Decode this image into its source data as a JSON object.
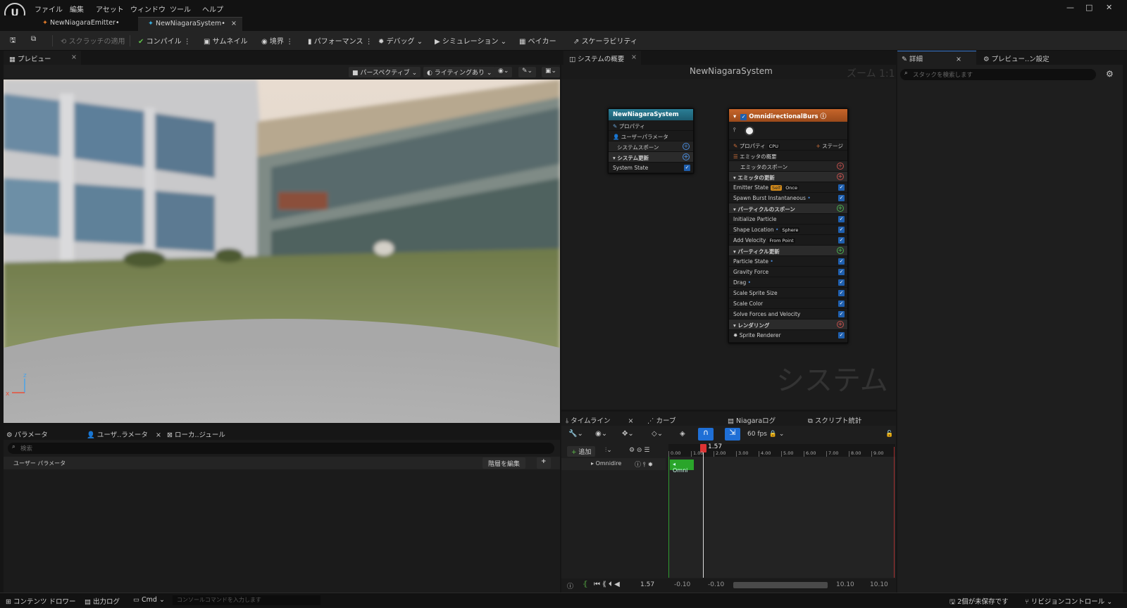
{
  "menu": {
    "items": [
      "ファイル",
      "編集",
      "アセット",
      "ウィンドウ",
      "ツール",
      "ヘルプ"
    ]
  },
  "tabs": [
    {
      "label": "NewNiagaraEmitter•"
    },
    {
      "label": "NewNiagaraSystem•"
    }
  ],
  "toolbar": {
    "save": "",
    "browse": "",
    "apply_scratch": "スクラッチの適用",
    "compile": "コンパイル",
    "thumbnail": "サムネイル",
    "bounds": "境界",
    "performance": "パフォーマンス",
    "debug": "デバッグ",
    "simulation": "シミュレーション",
    "baker": "ベイカー",
    "scalability": "スケーラビリティ"
  },
  "preview": {
    "tab": "プレビュー",
    "perspective": "パースペクティブ",
    "lighting": "ライティングあり"
  },
  "system_overview": {
    "tab": "システムの概要",
    "title": "NewNiagaraSystem",
    "zoom": "ズーム 1:1",
    "watermark": "システム"
  },
  "system_node": {
    "title": "NewNiagaraSystem",
    "rows": [
      "プロパティ",
      "ユーザーパラメータ",
      "システムスポーン",
      "システム更新",
      "System State"
    ]
  },
  "emitter_node": {
    "title": "OmnidirectionalBurs",
    "properties": "プロパティ",
    "cpu": "CPU",
    "stage": "ステージ",
    "rows": {
      "summary": "エミッタの概要",
      "spawn": "エミッタのスポーン",
      "update": "エミッタの更新",
      "emitter_state": "Emitter State",
      "self": "Self",
      "once": "Once",
      "spawn_burst": "Spawn Burst Instantaneous",
      "particle_spawn": "パーティクルのスポーン",
      "init_particle": "Initialize Particle",
      "shape_location": "Shape Location",
      "sphere": "Sphere",
      "add_velocity": "Add Velocity",
      "from_point": "From Point",
      "particle_update": "パーティクル更新",
      "particle_state": "Particle State",
      "gravity": "Gravity Force",
      "drag": "Drag",
      "scale_sprite": "Scale Sprite Size",
      "scale_color": "Scale Color",
      "solve_forces": "Solve Forces and Velocity",
      "rendering": "レンダリング",
      "sprite_renderer": "Sprite Renderer"
    }
  },
  "details": {
    "tab": "詳細",
    "preview_settings": "プレビュー..ン設定",
    "search_placeholder": "スタックを検索します"
  },
  "bottom_left": {
    "tab_params": "パラメータ",
    "tab_user": "ユーザ..ラメータ",
    "tab_local": "ローカ..ジュール",
    "search_placeholder": "検索",
    "section": "ユーザー パラメータ",
    "edit_hierarchy": "階層を編集"
  },
  "timeline": {
    "tab": "タイムライン",
    "curves": "カーブ",
    "niagara_log": "Niagaraログ",
    "script_stats": "スクリプト統計",
    "fps": "60 fps",
    "add": "追加",
    "track": "Omnidire",
    "clip": "Omni",
    "playhead": "1.57",
    "ticks": [
      "0.00",
      "1.00",
      "2.00",
      "3.00",
      "4.00",
      "5.00",
      "6.00",
      "7.00",
      "8.00",
      "9.00"
    ],
    "time_readout": "1.57",
    "range_start": "-0.10",
    "range_start2": "-0.10",
    "range_end": "10.10",
    "range_end2": "10.10"
  },
  "statusbar": {
    "content_drawer": "コンテンツ ドロワー",
    "output_log": "出力ログ",
    "cmd": "Cmd",
    "console_placeholder": "コンソールコマンドを入力します",
    "unsaved": "2個が未保存です",
    "revision": "リビジョンコントロール"
  }
}
